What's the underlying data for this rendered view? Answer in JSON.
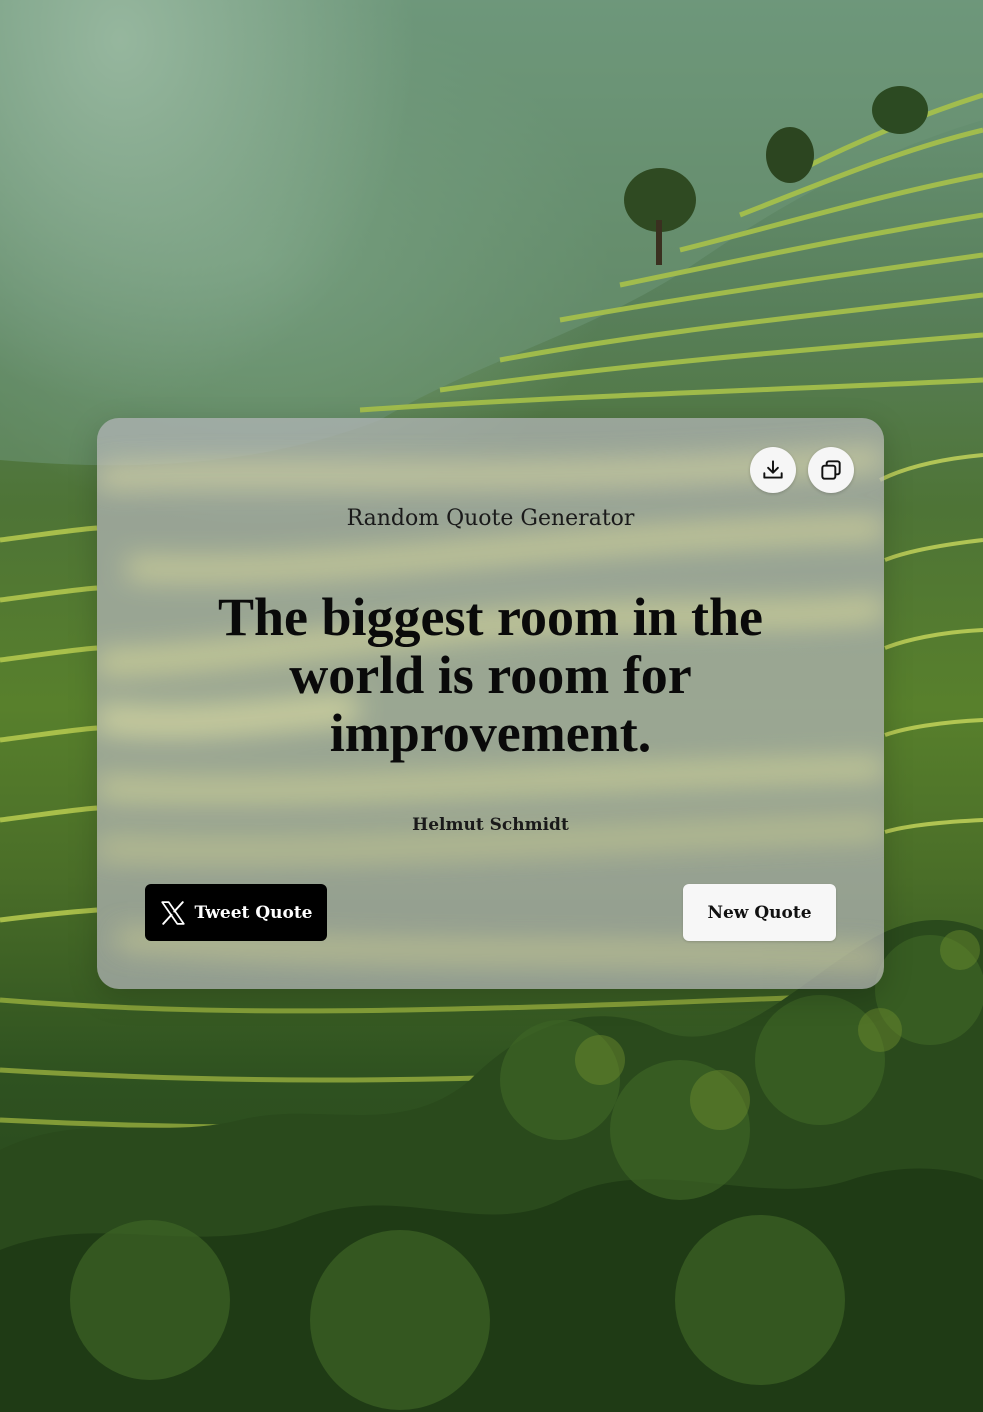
{
  "app": {
    "title": "Random Quote Generator"
  },
  "quote": {
    "text": "The biggest room in the world is room for improvement.",
    "author": "Helmut Schmidt"
  },
  "actions": {
    "tweet_label": "Tweet Quote",
    "new_quote_label": "New Quote",
    "download_icon": "download-icon",
    "copy_icon": "copy-icon",
    "x_icon": "x-logo-icon"
  },
  "colors": {
    "card_glass": "#b4b6ba",
    "tweet_button_bg": "#000000",
    "new_button_bg": "#f7f7f7",
    "icon_button_bg": "#f6f6f6"
  }
}
